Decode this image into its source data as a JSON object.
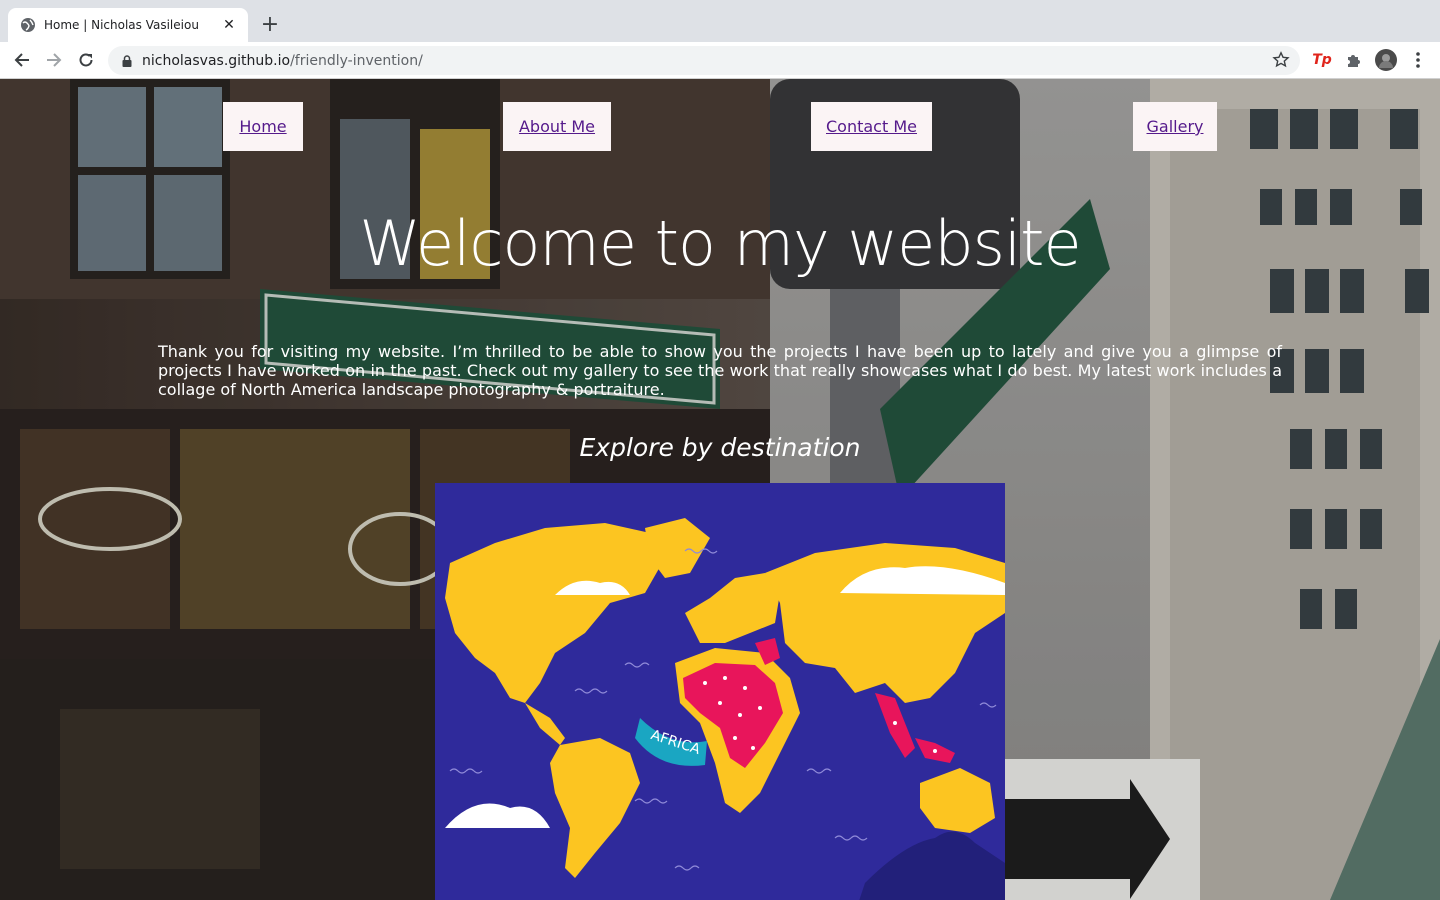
{
  "browser": {
    "tab_title": "Home | Nicholas Vasileiou",
    "tab_close": "✕",
    "new_tab": "+",
    "url_host": "nicholasvas.github.io",
    "url_path": "/friendly-invention/",
    "extension_badge": "Tp"
  },
  "nav": {
    "home": "Home",
    "about": "About Me",
    "contact": "Contact Me",
    "gallery": "Gallery"
  },
  "hero": {
    "title": "Welcome to my website",
    "intro": "Thank you for visiting my website. I’m thrilled to be able to show you the projects I have been up to lately and give you a glimpse of projects I have worked on in the past. Check out my gallery to see the work that really showcases what I do best. My latest work includes a collage of North America landscape photography & portraiture.",
    "explore": "Explore by destination"
  },
  "map": {
    "label": "AFRICA",
    "colors": {
      "ocean": "#2f2a9b",
      "land": "#fcc521",
      "highlight": "#e8155b",
      "banner": "#1aa6c2",
      "cloud": "#ffffff"
    }
  },
  "icons": [
    "globe-icon",
    "close-icon",
    "plus-icon",
    "back-arrow-icon",
    "forward-arrow-icon",
    "reload-icon",
    "lock-icon",
    "star-icon",
    "extension-icon",
    "puzzle-icon",
    "avatar",
    "kebab-menu-icon"
  ]
}
